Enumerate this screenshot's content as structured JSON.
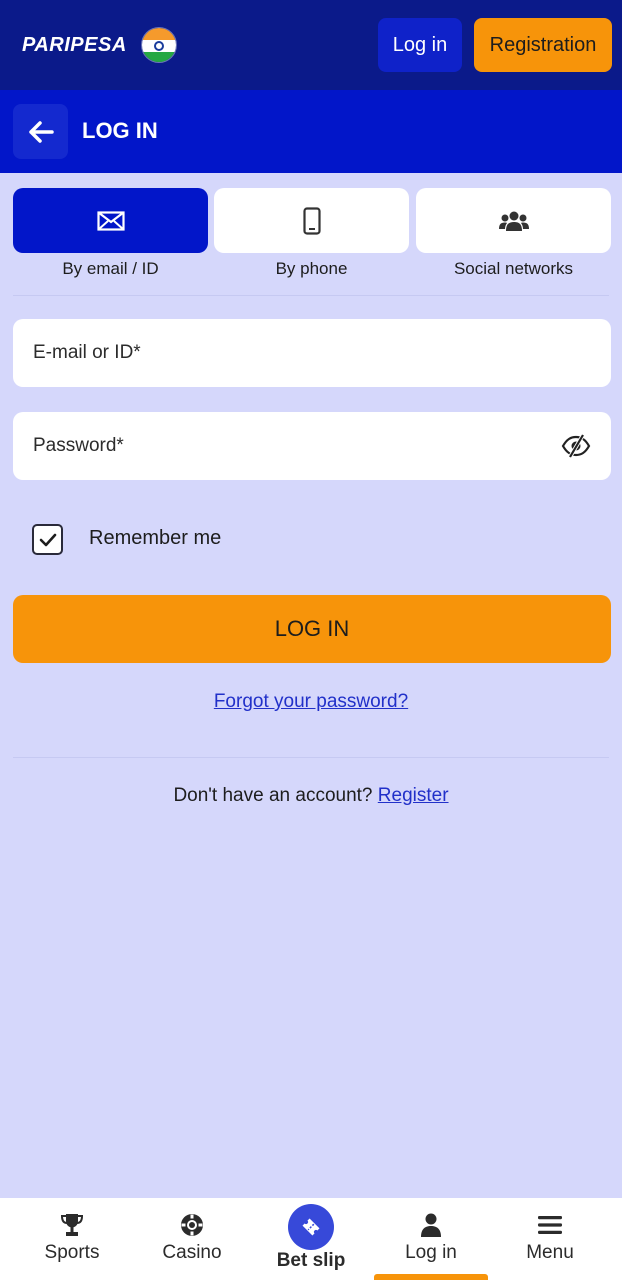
{
  "header": {
    "logo_text": "PARIPESA",
    "flag_icon": "india-flag-icon",
    "login_label": "Log in",
    "registration_label": "Registration"
  },
  "subheader": {
    "back_icon": "arrow-left-icon",
    "title": "LOG IN"
  },
  "login_methods": [
    {
      "label": "By email / ID",
      "icon": "envelope-icon",
      "active": true
    },
    {
      "label": "By phone",
      "icon": "phone-icon",
      "active": false
    },
    {
      "label": "Social networks",
      "icon": "users-icon",
      "active": false
    }
  ],
  "form": {
    "email_placeholder": "E-mail or ID*",
    "email_value": "",
    "password_placeholder": "Password*",
    "password_value": "",
    "password_toggle_icon": "eye-slash-icon",
    "remember_label": "Remember me",
    "remember_checked": true,
    "submit_label": "LOG IN",
    "forgot_label": "Forgot your password?"
  },
  "signup": {
    "prompt": "Don't have an account?",
    "link_label": "Register"
  },
  "bottom_nav": [
    {
      "label": "Sports",
      "icon": "trophy-icon"
    },
    {
      "label": "Casino",
      "icon": "casino-chip-icon"
    },
    {
      "label": "Bet slip",
      "icon": "ticket-icon"
    },
    {
      "label": "Log in",
      "icon": "user-icon",
      "active": true
    },
    {
      "label": "Menu",
      "icon": "hamburger-menu-icon"
    }
  ],
  "colors": {
    "header_bg": "#0b1a8a",
    "subheader_bg": "#0216c9",
    "page_bg": "#d5d7fb",
    "accent_orange": "#f7940a",
    "link_blue": "#2130c9"
  }
}
